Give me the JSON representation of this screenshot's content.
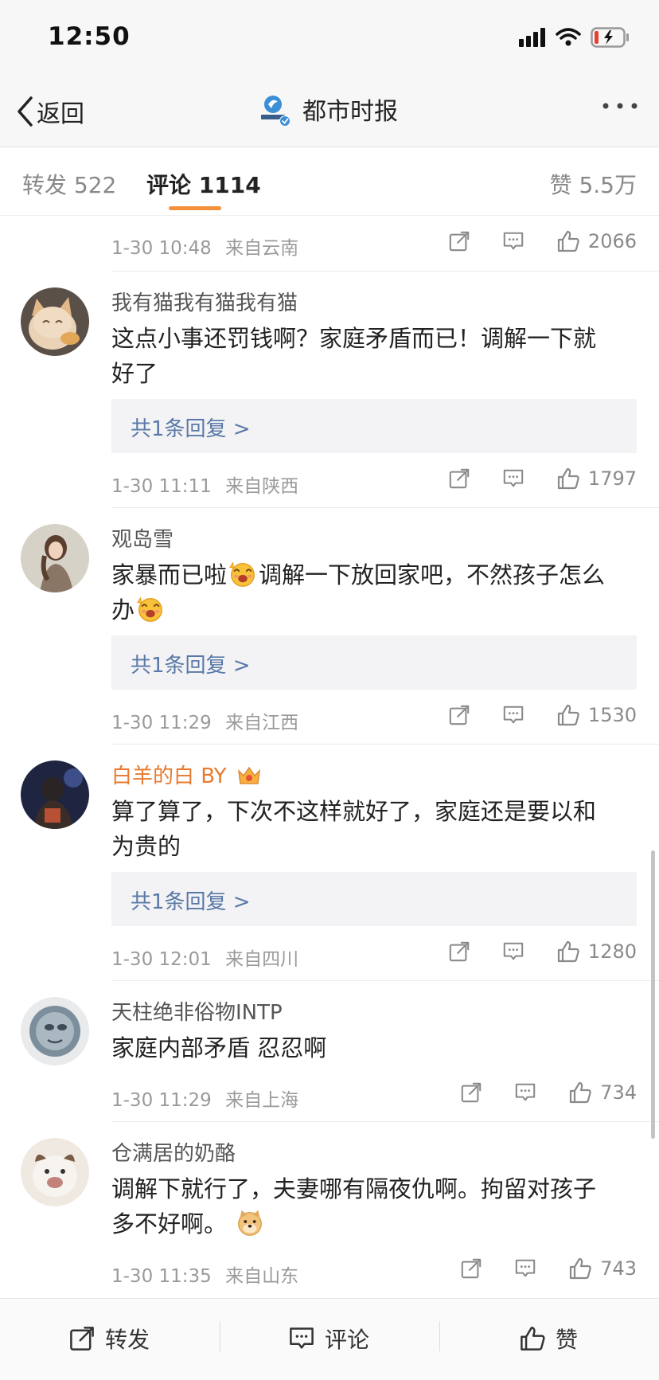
{
  "status_bar": {
    "time": "12:50"
  },
  "nav": {
    "back_label": "返回",
    "title": "都市时报"
  },
  "tabs": {
    "repost": "转发 522",
    "comment": "评论 1114",
    "like": "赞 5.5万"
  },
  "top_meta": {
    "time": "1-30 10:48",
    "location": "来自云南",
    "likes": "2066"
  },
  "comments": [
    {
      "username": "我有猫我有猫我有猫",
      "text_line1": "这点小事还罚钱啊？家庭矛盾而已！调解一下就",
      "text_line2": "好了",
      "reply": "共1条回复 >",
      "time": "1-30 11:11",
      "location": "来自陕西",
      "likes": "1797"
    },
    {
      "username": "观岛雪",
      "text_line1_a": "家暴而已啦",
      "text_line1_b": "调解一下放回家吧，不然孩子怎么",
      "text_line2": "办",
      "reply": "共1条回复 >",
      "time": "1-30 11:29",
      "location": "来自江西",
      "likes": "1530"
    },
    {
      "username": "白羊的白 BY",
      "text_line1": "算了算了，下次不这样就好了，家庭还是要以和",
      "text_line2": "为贵的",
      "reply": "共1条回复 >",
      "time": "1-30 12:01",
      "location": "来自四川",
      "likes": "1280"
    },
    {
      "username": "天柱绝非俗物INTP",
      "text_line1": "家庭内部矛盾 忍忍啊",
      "time": "1-30 11:29",
      "location": "来自上海",
      "likes": "734"
    },
    {
      "username": "仓满居的奶酪",
      "text_line1": "调解下就行了，夫妻哪有隔夜仇啊。拘留对孩子",
      "text_line2": "多不好啊。",
      "time": "1-30 11:35",
      "location": "来自山东",
      "likes": "743"
    }
  ],
  "bottom_bar": {
    "repost": "转发",
    "comment": "评论",
    "like": "赞"
  },
  "icons": {
    "back": "chevron-left-icon",
    "logo": "newspaper-logo",
    "verified": "verified-badge-icon",
    "more": "more-dots-icon",
    "share": "share-icon",
    "comment": "comment-icon",
    "like": "thumbs-up-icon",
    "emoji": "laughing-face-emoji",
    "doge": "doge-emoji",
    "vip": "crown-badge-icon"
  },
  "colors": {
    "accent": "#f5913d",
    "link": "#5a79a8",
    "vip_name": "#e8792e",
    "meta": "#9a9a9a"
  }
}
